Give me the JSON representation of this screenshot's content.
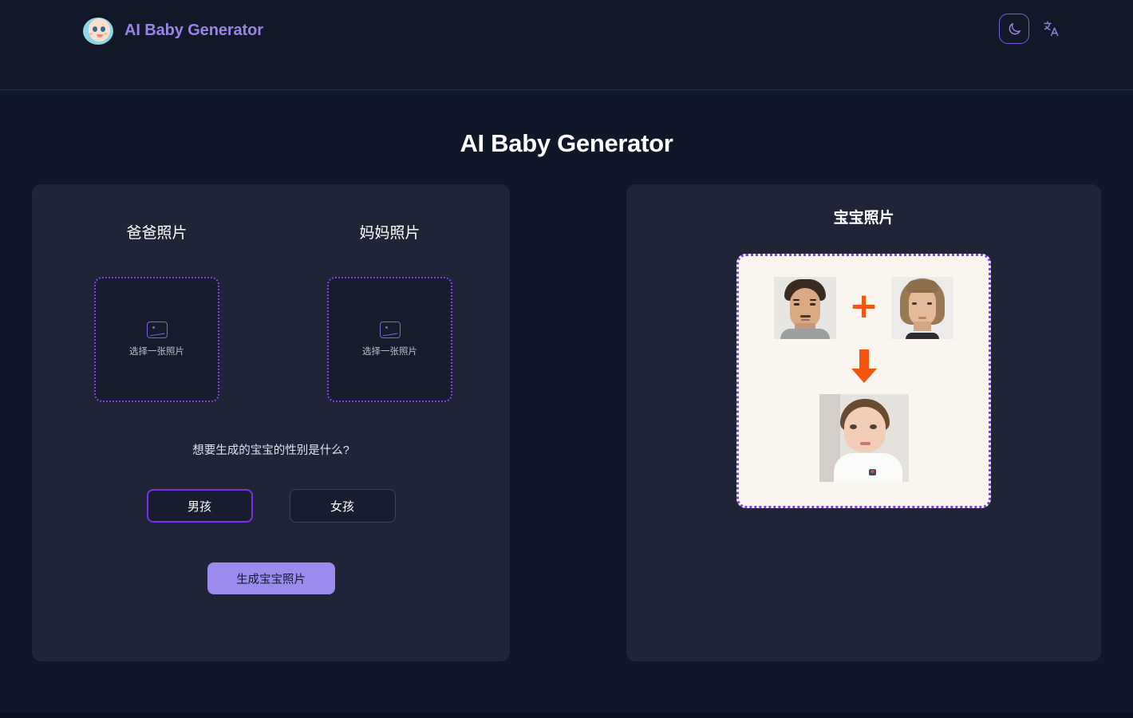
{
  "header": {
    "brand_title": "AI Baby Generator",
    "logo_icon": "baby-face-icon",
    "theme_toggle_icon": "moon-icon",
    "language_icon": "translate-icon"
  },
  "page": {
    "title": "AI Baby Generator"
  },
  "uploader": {
    "father": {
      "label": "爸爸照片",
      "dropzone_text": "选择一张照片",
      "dropzone_icon": "image-placeholder-icon"
    },
    "mother": {
      "label": "妈妈照片",
      "dropzone_text": "选择一张照片",
      "dropzone_icon": "image-placeholder-icon"
    }
  },
  "gender": {
    "question": "想要生成的宝宝的性别是什么?",
    "options": [
      {
        "label": "男孩",
        "selected": true
      },
      {
        "label": "女孩",
        "selected": false
      }
    ]
  },
  "actions": {
    "generate_label": "生成宝宝照片"
  },
  "preview": {
    "title": "宝宝照片",
    "plus_symbol": "+",
    "arrow_icon": "down-arrow-icon",
    "father_photo_alt": "father-example-photo",
    "mother_photo_alt": "mother-example-photo",
    "baby_photo_alt": "baby-example-photo"
  },
  "colors": {
    "background": "#101728",
    "panel": "#1f2437",
    "brand_purple": "#9b84e8",
    "accent_purple": "#7c2fe8",
    "generate_button": "#9b8bec",
    "preview_card": "#faf5ef",
    "accent_orange": "#f4560f"
  }
}
